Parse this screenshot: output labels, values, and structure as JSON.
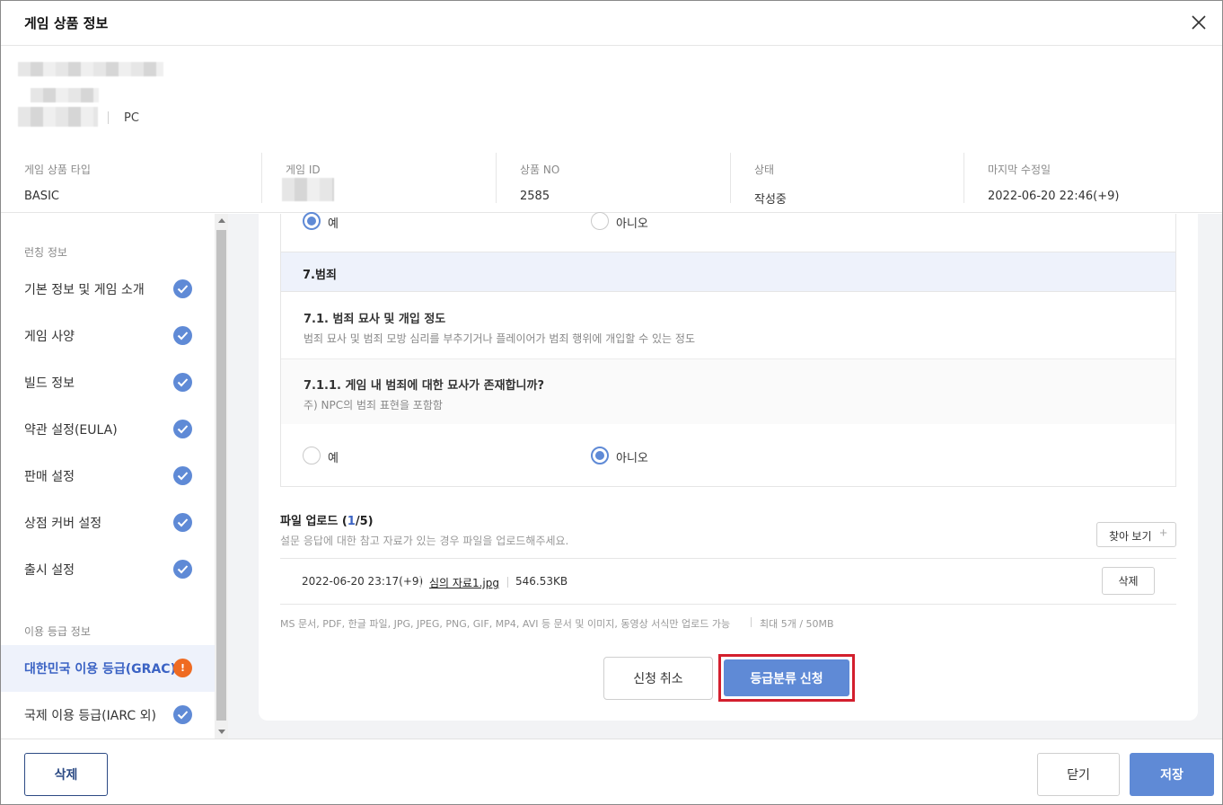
{
  "modal": {
    "title": "게임 상품 정보"
  },
  "product": {
    "platform": "PC"
  },
  "info": [
    {
      "label": "게임 상품 타입",
      "value": "BASIC"
    },
    {
      "label": "게임 ID",
      "value": ""
    },
    {
      "label": "상품 NO",
      "value": "2585"
    },
    {
      "label": "상태",
      "value": "작성중"
    },
    {
      "label": "마지막 수정일",
      "value": "2022-06-20 22:46(+9)"
    }
  ],
  "sidebar": {
    "section1": "런칭 정보",
    "section2": "이용 등급 정보",
    "items": [
      {
        "label": "기본 정보 및 게임 소개",
        "status": "complete"
      },
      {
        "label": "게임 사양",
        "status": "complete"
      },
      {
        "label": "빌드 정보",
        "status": "complete"
      },
      {
        "label": "약관 설정(EULA)",
        "status": "complete"
      },
      {
        "label": "판매 설정",
        "status": "complete"
      },
      {
        "label": "상점 커버 설정",
        "status": "complete"
      },
      {
        "label": "출시 설정",
        "status": "complete"
      }
    ],
    "rating_items": [
      {
        "label": "대한민국 이용 등급(GRAC)",
        "status": "warning",
        "badge": "!"
      },
      {
        "label": "국제 이용 등급(IARC 외)",
        "status": "complete"
      }
    ]
  },
  "questionnaire": {
    "prev_answer": {
      "yes": "예",
      "no": "아니오",
      "selected": "yes"
    },
    "category": "7.범죄",
    "sub_title": "7.1. 범죄 묘사 및 개입 정도",
    "sub_desc": "범죄 묘사 및 범죄 모방 심리를 부추기거나 플레이어가 범죄 행위에 개입할 수 있는 정도",
    "question_title": "7.1.1. 게임 내 범죄에 대한 묘사가 존재합니까?",
    "question_note": "주) NPC의 범죄 표현을 포함함",
    "answer": {
      "yes": "예",
      "no": "아니오",
      "selected": "no"
    }
  },
  "upload": {
    "title": "파일 업로드",
    "count": "1",
    "max": "5",
    "desc": "설문 응답에 대한 참고 자료가 있는 경우 파일을 업로드해주세요.",
    "browse_label": "찾아 보기",
    "file": {
      "date": "2022-06-20 23:17(+9)",
      "name": "심의 자료1.jpg",
      "size": "546.53KB",
      "delete_label": "삭제"
    },
    "formats": "MS 문서, PDF, 한글 파일, JPG, JPEG, PNG, GIF, MP4, AVI 등 문서 및 이미지, 동영상 서식만 업로드 가능",
    "limit": "최대 5개 / 50MB"
  },
  "actions": {
    "cancel_request": "신청 취소",
    "submit_rating": "등급분류 신청"
  },
  "footer": {
    "delete": "삭제",
    "close": "닫기",
    "save": "저장"
  },
  "colors": {
    "accent": "#5f8ad6",
    "warning": "#ef6b22",
    "highlight": "#d31f2d",
    "navy": "#2c4a84"
  }
}
